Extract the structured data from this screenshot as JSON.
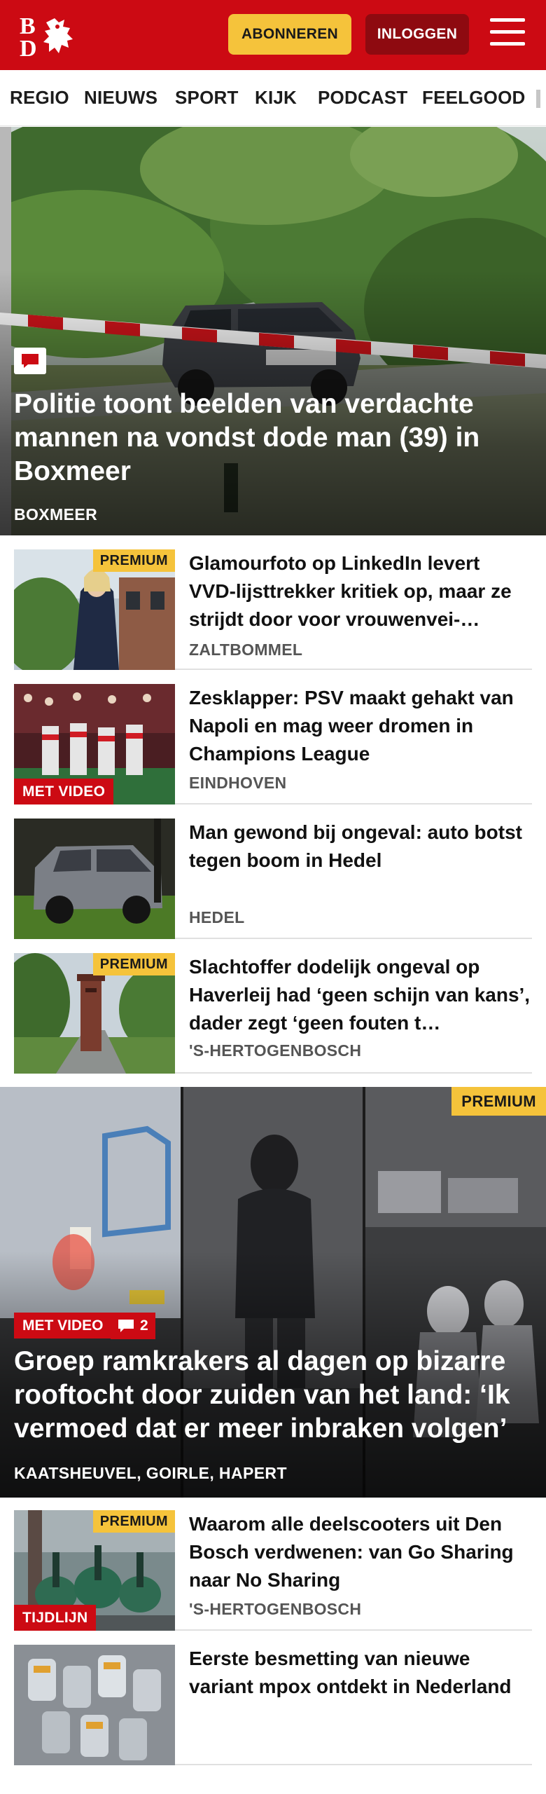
{
  "header": {
    "logo_letters": "BD",
    "subscribe_label": "ABONNEREN",
    "login_label": "INLOGGEN",
    "menu_icon": "hamburger-icon",
    "brand_color": "#cc0a13",
    "accent_color": "#f5c33b"
  },
  "nav": {
    "items": [
      "REGIO",
      "NIEUWS",
      "SPORT",
      "KIJK",
      "PODCAST",
      "FEELGOOD"
    ]
  },
  "hero": {
    "title": "Politie toont beelden van verdachte mannen na vondst dode man (39) in Boxmeer",
    "location": "BOXMEER",
    "comment_icon": "comment-icon"
  },
  "articles": [
    {
      "title": "Glamourfoto op LinkedIn levert VVD-lijsttrekker kritiek op, maar ze strijdt door voor vrouwenvei-…",
      "location": "ZALTBOMMEL",
      "premium": "PREMIUM"
    },
    {
      "title": "Zesklapper: PSV maakt gehakt van Napoli en mag weer dromen in Champions League",
      "location": "EINDHOVEN",
      "tag": "MET VIDEO"
    },
    {
      "title": "Man gewond bij ongeval: auto botst tegen boom in Hedel",
      "location": "HEDEL"
    },
    {
      "title": "Slachtoffer dodelijk ongeval op Haverleij had ‘geen schijn van kans’, dader zegt ‘geen fouten t…",
      "location": "'S-HERTOGENBOSCH",
      "premium": "PREMIUM"
    }
  ],
  "feature": {
    "title": "Groep ramkrakers al dagen op bizarre rooftocht door zuiden van het land: ‘Ik vermoed dat er meer inbraken volgen’",
    "location": "KAATSHEUVEL, GOIRLE, HAPERT",
    "video_tag": "MET VIDEO",
    "comment_count": "2",
    "premium": "PREMIUM"
  },
  "articles2": [
    {
      "title": "Waarom alle deelscooters uit Den Bosch verdwenen: van Go Sharing naar No Sharing",
      "location": "'S-HERTOGENBOSCH",
      "premium": "PREMIUM",
      "tag": "TIJDLIJN"
    },
    {
      "title": "Eerste besmetting van nieuwe variant mpox ontdekt in Nederland",
      "location": ""
    }
  ]
}
